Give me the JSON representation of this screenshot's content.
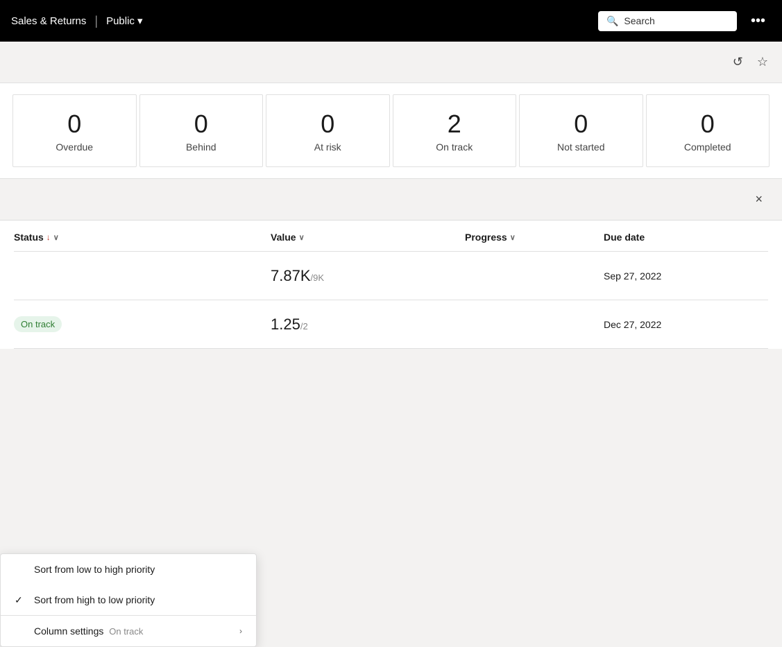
{
  "topbar": {
    "title": "Sales & Returns",
    "separator": "|",
    "visibility": "Public",
    "chevron": "▾",
    "search_placeholder": "Search",
    "more_icon": "•••"
  },
  "secondary": {
    "refresh_icon": "↺",
    "star_icon": "☆"
  },
  "stats": [
    {
      "value": "0",
      "label": "Overdue"
    },
    {
      "value": "0",
      "label": "Behind"
    },
    {
      "value": "0",
      "label": "At risk"
    },
    {
      "value": "2",
      "label": "On track"
    },
    {
      "value": "0",
      "label": "Not started"
    },
    {
      "value": "0",
      "label": "Completed"
    }
  ],
  "close_icon": "×",
  "table": {
    "headers": {
      "status": "Status",
      "sort_icon": "↓",
      "chevron": "∨",
      "value": "Value",
      "progress": "Progress",
      "duedate": "Due date"
    },
    "rows": [
      {
        "status_label": "",
        "value_main": "7.87K",
        "value_sub": "/9K",
        "due_date": "Sep 27, 2022"
      },
      {
        "status_label": "On track",
        "value_main": "1.25",
        "value_sub": "/2",
        "due_date": "Dec 27, 2022"
      }
    ]
  },
  "dropdown": {
    "item1": "Sort from low to high priority",
    "item2": "Sort from high to low priority",
    "item3": "Column settings",
    "item3_sub": "On track",
    "arrow": "›"
  }
}
